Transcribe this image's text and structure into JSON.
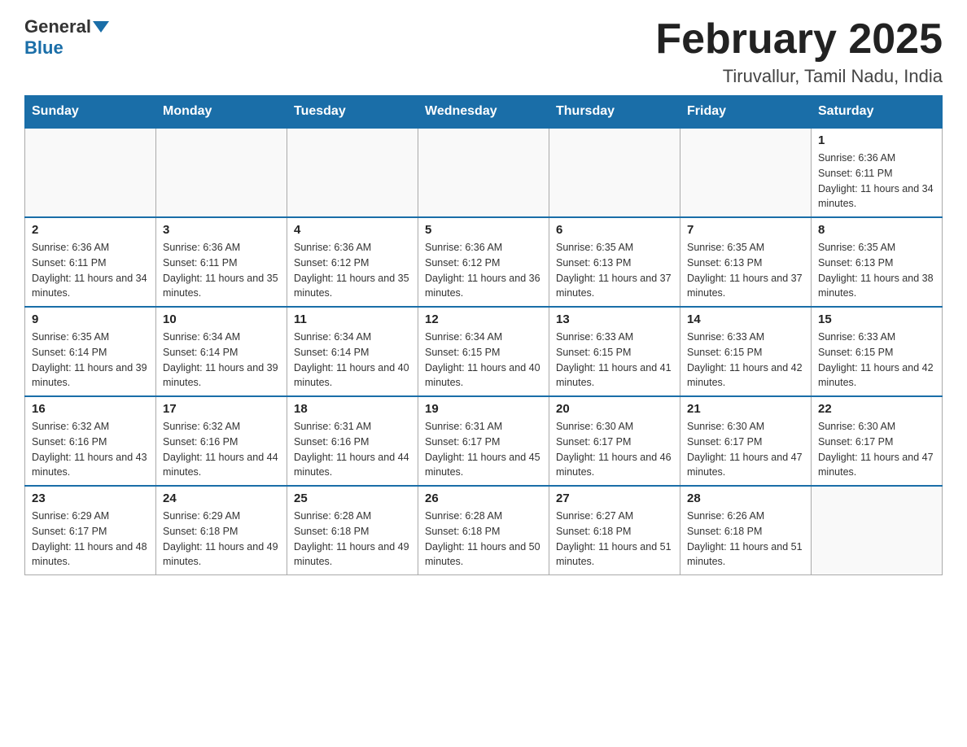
{
  "header": {
    "logo_general": "General",
    "logo_blue": "Blue",
    "month_title": "February 2025",
    "location": "Tiruvallur, Tamil Nadu, India"
  },
  "days_of_week": [
    "Sunday",
    "Monday",
    "Tuesday",
    "Wednesday",
    "Thursday",
    "Friday",
    "Saturday"
  ],
  "weeks": [
    [
      {
        "day": "",
        "info": ""
      },
      {
        "day": "",
        "info": ""
      },
      {
        "day": "",
        "info": ""
      },
      {
        "day": "",
        "info": ""
      },
      {
        "day": "",
        "info": ""
      },
      {
        "day": "",
        "info": ""
      },
      {
        "day": "1",
        "info": "Sunrise: 6:36 AM\nSunset: 6:11 PM\nDaylight: 11 hours and 34 minutes."
      }
    ],
    [
      {
        "day": "2",
        "info": "Sunrise: 6:36 AM\nSunset: 6:11 PM\nDaylight: 11 hours and 34 minutes."
      },
      {
        "day": "3",
        "info": "Sunrise: 6:36 AM\nSunset: 6:11 PM\nDaylight: 11 hours and 35 minutes."
      },
      {
        "day": "4",
        "info": "Sunrise: 6:36 AM\nSunset: 6:12 PM\nDaylight: 11 hours and 35 minutes."
      },
      {
        "day": "5",
        "info": "Sunrise: 6:36 AM\nSunset: 6:12 PM\nDaylight: 11 hours and 36 minutes."
      },
      {
        "day": "6",
        "info": "Sunrise: 6:35 AM\nSunset: 6:13 PM\nDaylight: 11 hours and 37 minutes."
      },
      {
        "day": "7",
        "info": "Sunrise: 6:35 AM\nSunset: 6:13 PM\nDaylight: 11 hours and 37 minutes."
      },
      {
        "day": "8",
        "info": "Sunrise: 6:35 AM\nSunset: 6:13 PM\nDaylight: 11 hours and 38 minutes."
      }
    ],
    [
      {
        "day": "9",
        "info": "Sunrise: 6:35 AM\nSunset: 6:14 PM\nDaylight: 11 hours and 39 minutes."
      },
      {
        "day": "10",
        "info": "Sunrise: 6:34 AM\nSunset: 6:14 PM\nDaylight: 11 hours and 39 minutes."
      },
      {
        "day": "11",
        "info": "Sunrise: 6:34 AM\nSunset: 6:14 PM\nDaylight: 11 hours and 40 minutes."
      },
      {
        "day": "12",
        "info": "Sunrise: 6:34 AM\nSunset: 6:15 PM\nDaylight: 11 hours and 40 minutes."
      },
      {
        "day": "13",
        "info": "Sunrise: 6:33 AM\nSunset: 6:15 PM\nDaylight: 11 hours and 41 minutes."
      },
      {
        "day": "14",
        "info": "Sunrise: 6:33 AM\nSunset: 6:15 PM\nDaylight: 11 hours and 42 minutes."
      },
      {
        "day": "15",
        "info": "Sunrise: 6:33 AM\nSunset: 6:15 PM\nDaylight: 11 hours and 42 minutes."
      }
    ],
    [
      {
        "day": "16",
        "info": "Sunrise: 6:32 AM\nSunset: 6:16 PM\nDaylight: 11 hours and 43 minutes."
      },
      {
        "day": "17",
        "info": "Sunrise: 6:32 AM\nSunset: 6:16 PM\nDaylight: 11 hours and 44 minutes."
      },
      {
        "day": "18",
        "info": "Sunrise: 6:31 AM\nSunset: 6:16 PM\nDaylight: 11 hours and 44 minutes."
      },
      {
        "day": "19",
        "info": "Sunrise: 6:31 AM\nSunset: 6:17 PM\nDaylight: 11 hours and 45 minutes."
      },
      {
        "day": "20",
        "info": "Sunrise: 6:30 AM\nSunset: 6:17 PM\nDaylight: 11 hours and 46 minutes."
      },
      {
        "day": "21",
        "info": "Sunrise: 6:30 AM\nSunset: 6:17 PM\nDaylight: 11 hours and 47 minutes."
      },
      {
        "day": "22",
        "info": "Sunrise: 6:30 AM\nSunset: 6:17 PM\nDaylight: 11 hours and 47 minutes."
      }
    ],
    [
      {
        "day": "23",
        "info": "Sunrise: 6:29 AM\nSunset: 6:17 PM\nDaylight: 11 hours and 48 minutes."
      },
      {
        "day": "24",
        "info": "Sunrise: 6:29 AM\nSunset: 6:18 PM\nDaylight: 11 hours and 49 minutes."
      },
      {
        "day": "25",
        "info": "Sunrise: 6:28 AM\nSunset: 6:18 PM\nDaylight: 11 hours and 49 minutes."
      },
      {
        "day": "26",
        "info": "Sunrise: 6:28 AM\nSunset: 6:18 PM\nDaylight: 11 hours and 50 minutes."
      },
      {
        "day": "27",
        "info": "Sunrise: 6:27 AM\nSunset: 6:18 PM\nDaylight: 11 hours and 51 minutes."
      },
      {
        "day": "28",
        "info": "Sunrise: 6:26 AM\nSunset: 6:18 PM\nDaylight: 11 hours and 51 minutes."
      },
      {
        "day": "",
        "info": ""
      }
    ]
  ]
}
